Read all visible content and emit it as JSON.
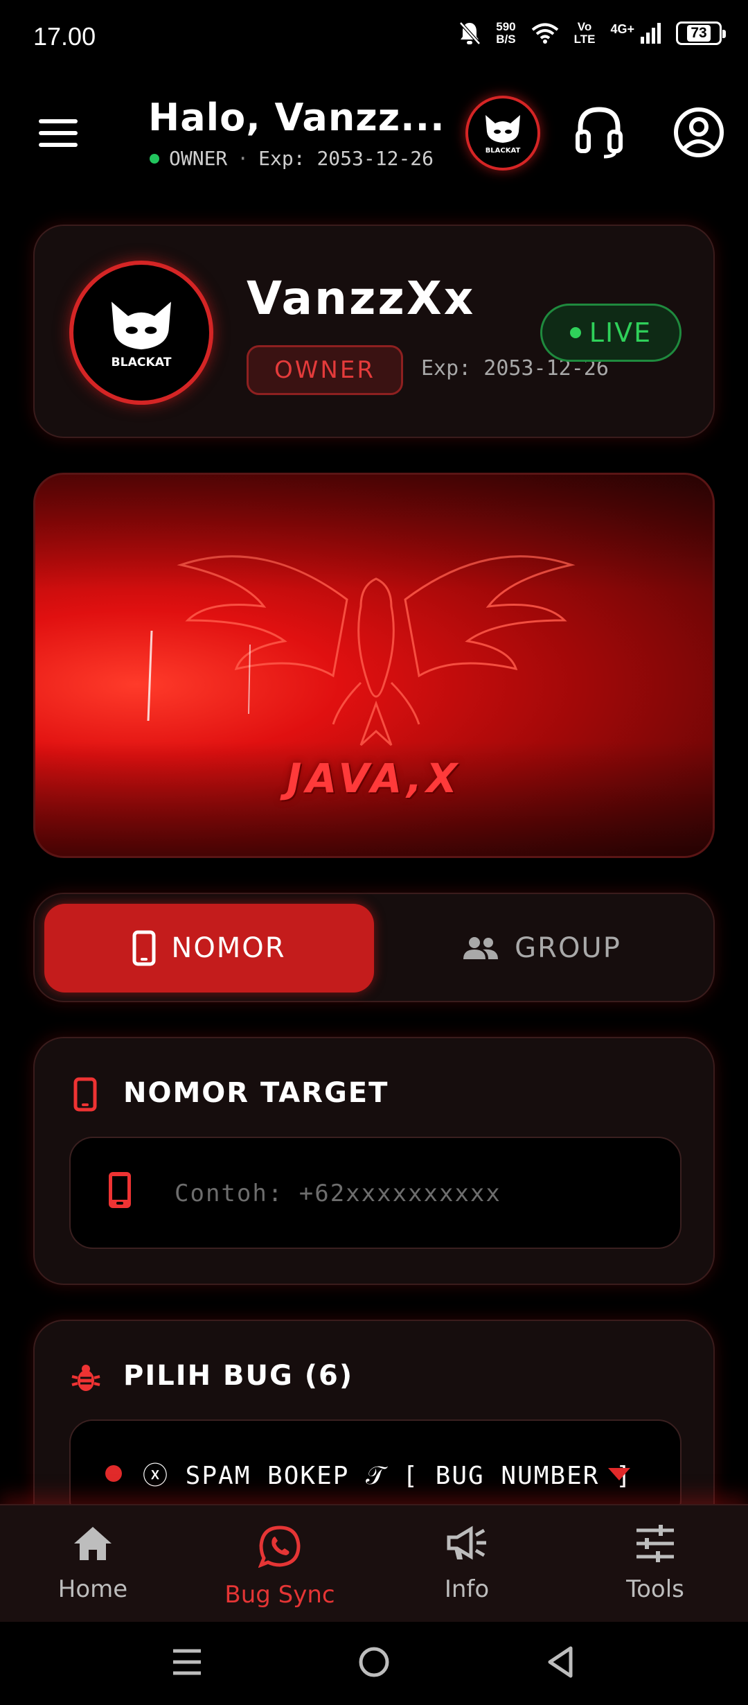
{
  "status_bar": {
    "time": "17.00",
    "net_speed_value": "590",
    "net_speed_unit": "B/S",
    "volte_top": "Vo",
    "volte_bottom": "LTE",
    "network": "4G+",
    "battery": "73"
  },
  "header": {
    "greeting": "Halo, Vanzz...",
    "role": "OWNER",
    "separator": "·",
    "expiry": "Exp: 2053-12-26",
    "logo_text": "BLACKAT",
    "icons": [
      "menu-icon",
      "headset-icon",
      "profile-icon"
    ]
  },
  "profile": {
    "name": "VanzzXx",
    "role_badge": "OWNER",
    "expiry": "Exp: 2053-12-26",
    "status": "LIVE",
    "logo_text": "BLACKAT"
  },
  "banner": {
    "text": "JAVA,X"
  },
  "tabs": [
    {
      "label": "NOMOR",
      "icon": "phone-icon",
      "active": true
    },
    {
      "label": "GROUP",
      "icon": "group-icon",
      "active": false
    }
  ],
  "target": {
    "title": "NOMOR TARGET",
    "placeholder": "Contoh: +62xxxxxxxxxx"
  },
  "bug": {
    "title": "PILIH BUG (6)",
    "selected": "ⓧ SPAM BOKEP 𝒯 [ BUG NUMBER ]"
  },
  "bottom_nav": [
    {
      "label": "Home",
      "icon": "home-icon",
      "active": false
    },
    {
      "label": "Bug Sync",
      "icon": "whatsapp-icon",
      "active": true
    },
    {
      "label": "Info",
      "icon": "megaphone-icon",
      "active": false
    },
    {
      "label": "Tools",
      "icon": "sliders-icon",
      "active": false
    }
  ],
  "colors": {
    "accent": "#c41c1c",
    "live": "#2fd15a",
    "background": "#000000",
    "card": "#160d0d"
  }
}
